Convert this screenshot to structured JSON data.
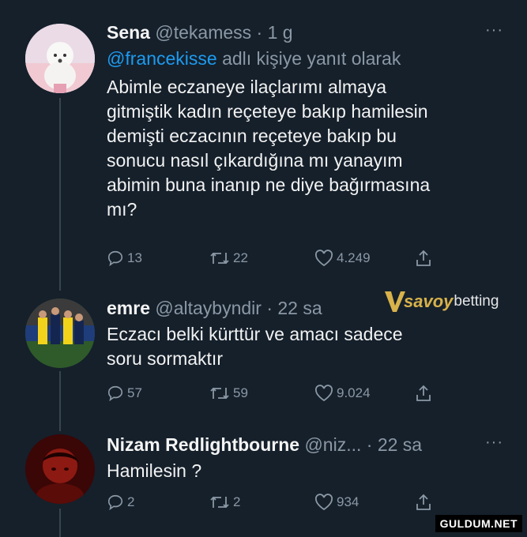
{
  "tweets": [
    {
      "name": "Sena",
      "handle": "@tekamess",
      "time": "· 1 g",
      "more": "···",
      "reply_mention": "@francekisse",
      "reply_suffix": " adlı kişiye yanıt olarak",
      "text_lines": [
        "Abimle eczaneye ilaçlarımı almaya",
        "gitmiştik kadın reçeteye bakıp hamilesin",
        "demişti eczacının reçeteye bakıp bu",
        "sonucu nasıl çıkardığına mı yanayım",
        "abimin buna inanıp ne diye bağırmasına",
        "mı?"
      ],
      "replies": "13",
      "retweets": "22",
      "likes": "4.249"
    },
    {
      "name": "emre",
      "handle": "@altaybyndir",
      "time": "· 22 sa",
      "text_lines": [
        "Eczacı belki kürttür ve amacı sadece",
        "soru sormaktır"
      ],
      "replies": "57",
      "retweets": "59",
      "likes": "9.024"
    },
    {
      "name": "Nizam Redlightbourne",
      "handle": "@niz...",
      "time": "· 22 sa",
      "more": "···",
      "text_lines": [
        "Hamilesin ?"
      ],
      "replies": "2",
      "retweets": "2",
      "likes": "934"
    }
  ],
  "watermark": {
    "brand_a": "savoy",
    "brand_b": "betting",
    "site": "GULDUM.NET"
  },
  "colors": {
    "background": "#15202b",
    "mention": "#1d9bf0",
    "muted": "#8b98a5"
  },
  "icons": [
    "reply-icon",
    "retweet-icon",
    "like-icon",
    "share-icon",
    "more-icon"
  ]
}
